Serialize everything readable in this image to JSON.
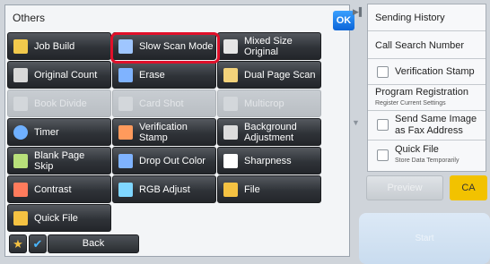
{
  "panel": {
    "title": "Others",
    "ok_label": "OK"
  },
  "grid": [
    {
      "label": "Job Build",
      "icon": "job-build-icon",
      "enabled": true
    },
    {
      "label": "Slow Scan Mode",
      "icon": "slow-scan-icon",
      "enabled": true,
      "highlighted": true
    },
    {
      "label": "Mixed Size Original",
      "icon": "mixed-size-icon",
      "enabled": true
    },
    {
      "label": "Original Count",
      "icon": "original-count-icon",
      "enabled": true
    },
    {
      "label": "Erase",
      "icon": "erase-icon",
      "enabled": true
    },
    {
      "label": "Dual Page Scan",
      "icon": "dual-page-icon",
      "enabled": true
    },
    {
      "label": "Book Divide",
      "icon": "book-divide-icon",
      "enabled": false
    },
    {
      "label": "Card Shot",
      "icon": "card-shot-icon",
      "enabled": false
    },
    {
      "label": "Multicrop",
      "icon": "multicrop-icon",
      "enabled": false
    },
    {
      "label": "Timer",
      "icon": "timer-icon",
      "enabled": true
    },
    {
      "label": "Verification Stamp",
      "icon": "verification-stamp-icon",
      "enabled": true
    },
    {
      "label": "Background Adjustment",
      "icon": "background-adjust-icon",
      "enabled": true
    },
    {
      "label": "Blank Page Skip",
      "icon": "blank-page-icon",
      "enabled": true
    },
    {
      "label": "Drop Out Color",
      "icon": "drop-out-color-icon",
      "enabled": true
    },
    {
      "label": "Sharpness",
      "icon": "sharpness-icon",
      "enabled": true
    },
    {
      "label": "Contrast",
      "icon": "contrast-icon",
      "enabled": true
    },
    {
      "label": "RGB Adjust",
      "icon": "rgb-adjust-icon",
      "enabled": true
    },
    {
      "label": "File",
      "icon": "folder-icon",
      "enabled": true
    },
    {
      "label": "Quick File",
      "icon": "quick-file-icon",
      "enabled": true
    }
  ],
  "bottom": {
    "favorite_icon": "star-icon",
    "check_icon": "checkmark-icon",
    "back_label": "Back"
  },
  "right": {
    "sending_history": "Sending History",
    "call_search_number": "Call Search Number",
    "verification_stamp": "Verification Stamp",
    "program_registration": "Program Registration",
    "program_registration_sub": "Register Current Settings",
    "send_same_image": "Send Same Image as Fax Address",
    "quick_file": "Quick File",
    "quick_file_sub": "Store Data Temporarily",
    "preview_label": "Preview",
    "ca_label": "CA",
    "start_label": "Start"
  },
  "colors": {
    "accent_blue": "#0a64d8",
    "highlight_red": "#e0102a",
    "ca_yellow": "#f2c200"
  }
}
